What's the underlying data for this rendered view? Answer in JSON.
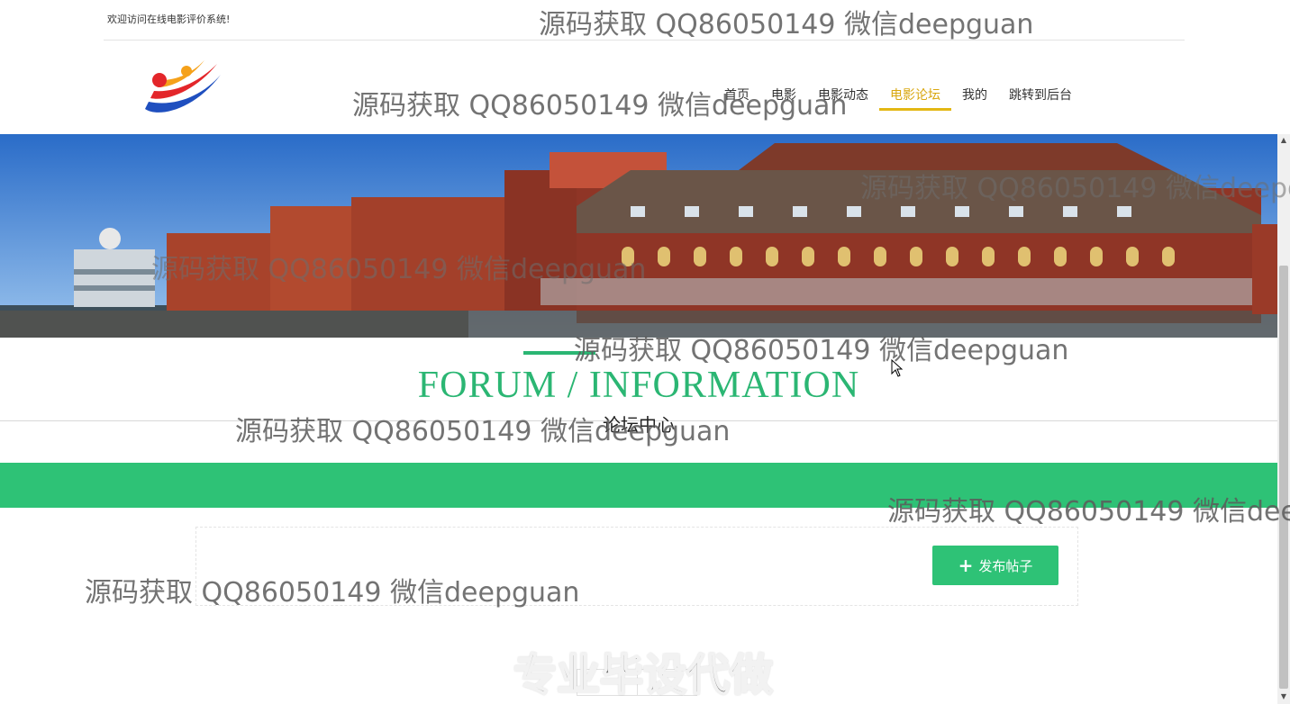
{
  "topbar": {
    "welcome": "欢迎访问在线电影评价系统!"
  },
  "nav": {
    "items": [
      {
        "label": "首页",
        "active": false
      },
      {
        "label": "电影",
        "active": false
      },
      {
        "label": "电影动态",
        "active": false
      },
      {
        "label": "电影论坛",
        "active": true
      },
      {
        "label": "我的",
        "active": false
      },
      {
        "label": "跳转到后台",
        "active": false
      }
    ]
  },
  "section": {
    "title": "FORUM / INFORMATION",
    "subtitle": "论坛中心"
  },
  "actions": {
    "publish_label": "发布帖子",
    "publish_icon": "plus-icon"
  },
  "watermarks": {
    "text": "源码获取 QQ86050149 微信deepguan",
    "text_cut_1": "源码获取 QQ86050149 微信deepg",
    "text_cut_2": "源码获取 QQ86050149 微信dee",
    "bold": "专业毕设代做"
  },
  "colors": {
    "accent_green": "#2ec276",
    "nav_active": "#d9a70f"
  }
}
